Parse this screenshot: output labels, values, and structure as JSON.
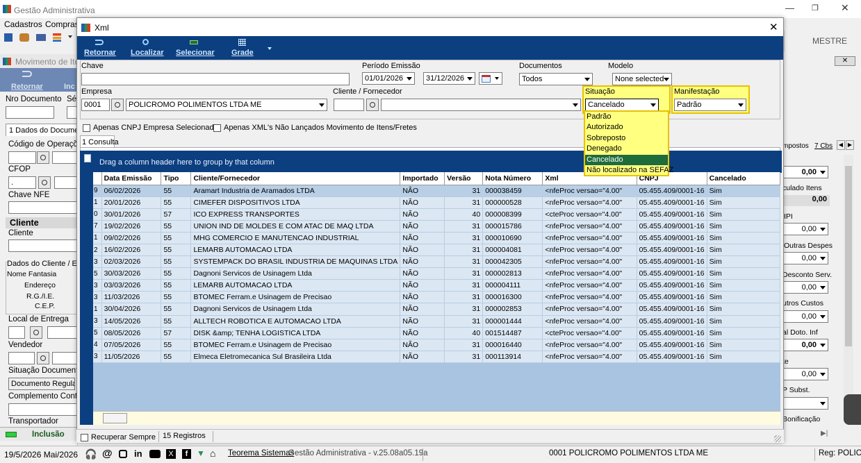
{
  "main_window": {
    "title": "Gestão Administrativa",
    "menu": [
      "Cadastros",
      "Compras"
    ],
    "user": "MESTRE"
  },
  "bg_window": {
    "title": "Movimento de Ite",
    "toolbar": [
      "Retornar",
      "Inc"
    ],
    "fields": {
      "nro_documento": "Nro Documento",
      "serie": "Sé",
      "tab": "1 Dados do Documen",
      "codigo_operacao": "Código de Operaçõ",
      "cfop": "CFOP",
      "cfop_value": ".",
      "chave_nfe": "Chave NFE",
      "cliente_header": "Cliente",
      "cliente": "Cliente",
      "dados_cliente": "Dados do Cliente / E",
      "nome_fantasia": "Nome Fantasia",
      "endereco": "Endereço",
      "rg_ie": "R.G./I.E.",
      "cep": "C.E.P.",
      "local_entrega": "Local de Entrega",
      "vendedor": "Vendedor",
      "situacao_documento": "Situação Documento",
      "situacao_value": "Documento Regular",
      "complemento": "Complemento Cont",
      "transportador": "Transportador"
    },
    "right_panel": {
      "tabs": [
        "mpostos",
        "7 Cbs"
      ],
      "values": [
        "0,00",
        "culado Itens",
        "0,00",
        "IPI",
        "0,00",
        "Outras Despes",
        "0,00",
        "Desconto Serv.",
        "0,00",
        "utros Custos",
        "0,00",
        "al Doto. Inf",
        "0,00",
        "te",
        "0,00",
        "P Subst.",
        "Bonificação"
      ]
    },
    "status_mode": "Inclusão"
  },
  "xml_window": {
    "title": "Xml",
    "toolbar": [
      {
        "label": "Retornar",
        "icon": "undo-icon"
      },
      {
        "label": "Localizar",
        "icon": "search-icon"
      },
      {
        "label": "Selecionar",
        "icon": "select-icon"
      },
      {
        "label": "Grade",
        "icon": "grid-icon"
      }
    ],
    "filters": {
      "chave_label": "Chave",
      "chave_value": "",
      "periodo_label": "Período Emissão",
      "data_inicio": "01/01/2026",
      "data_fim": "31/12/2026",
      "documentos_label": "Documentos",
      "documentos_value": "Todos",
      "modelo_label": "Modelo",
      "modelo_value": "None selected",
      "empresa_label": "Empresa",
      "empresa_codigo": "0001",
      "empresa_nome": "POLICROMO POLIMENTOS LTDA ME",
      "cliente_label": "Cliente / Fornecedor",
      "cliente_codigo": "",
      "cliente_nome": "",
      "situacao_label": "Situação",
      "situacao_value": "Cancelado",
      "manifestacao_label": "Manifestação",
      "manifestacao_value": "Padrão"
    },
    "situacao_options": [
      "Padrão",
      "Autorizado",
      "Sobreposto",
      "Denegado",
      "Cancelado",
      "Não localizado na SEFAZ"
    ],
    "checkboxes": [
      "Apenas CNPJ Empresa Selecionada",
      "Apenas XML's Não Lançados Movimento de Itens/Fretes"
    ],
    "tab": "1 Consulta",
    "group_hint": "Drag a column header here to group by that column",
    "columns": [
      "",
      "Data Emissão",
      "Tipo",
      "Cliente/Fornecedor",
      "Importado",
      "Versão",
      "Nota Número",
      "Xml",
      "CNPJ",
      "Cancelado"
    ],
    "rows": [
      [
        "9",
        "06/02/2026",
        "55",
        "Aramart Industria de Aramados LTDA",
        "NÃO",
        "31",
        "000038459",
        "<nfeProc versao=\"4.00\"",
        "05.455.409/0001-16",
        "Sim"
      ],
      [
        "1",
        "20/01/2026",
        "55",
        "CIMEFER DISPOSITIVOS LTDA",
        "NÃO",
        "31",
        "000000528",
        "<nfeProc versao=\"4.00\"",
        "05.455.409/0001-16",
        "Sim"
      ],
      [
        "0",
        "30/01/2026",
        "57",
        "ICO EXPRESS TRANSPORTES",
        "NÃO",
        "40",
        "000008399",
        "<cteProc versao=\"4.00\"",
        "05.455.409/0001-16",
        "Sim"
      ],
      [
        "7",
        "19/02/2026",
        "55",
        "UNION IND DE MOLDES E COM ATAC DE MAQ LTDA",
        "NÃO",
        "31",
        "000015786",
        "<nfeProc versao=\"4.00\"",
        "05.455.409/0001-16",
        "Sim"
      ],
      [
        "1",
        "09/02/2026",
        "55",
        "MHG COMERCIO E MANUTENCAO INDUSTRIAL",
        "NÃO",
        "31",
        "000010690",
        "<nfeProc versao=\"4.00\"",
        "05.455.409/0001-16",
        "Sim"
      ],
      [
        "2",
        "16/02/2026",
        "55",
        "LEMARB AUTOMACAO LTDA",
        "NÃO",
        "31",
        "000004081",
        "<nfeProc versao=\"4.00\"",
        "05.455.409/0001-16",
        "Sim"
      ],
      [
        "3",
        "02/03/2026",
        "55",
        "SYSTEMPACK DO BRASIL INDUSTRIA DE MAQUINAS LTDA",
        "NÃO",
        "31",
        "000042305",
        "<nfeProc versao=\"4.00\"",
        "05.455.409/0001-16",
        "Sim"
      ],
      [
        "5",
        "30/03/2026",
        "55",
        "Dagnoni Servicos de Usinagem Ltda",
        "NÃO",
        "31",
        "000002813",
        "<nfeProc versao=\"4.00\"",
        "05.455.409/0001-16",
        "Sim"
      ],
      [
        "3",
        "03/03/2026",
        "55",
        "LEMARB AUTOMACAO LTDA",
        "NÃO",
        "31",
        "000004111",
        "<nfeProc versao=\"4.00\"",
        "05.455.409/0001-16",
        "Sim"
      ],
      [
        "3",
        "11/03/2026",
        "55",
        "BTOMEC Ferram.e Usinagem de Precisao",
        "NÃO",
        "31",
        "000016300",
        "<nfeProc versao=\"4.00\"",
        "05.455.409/0001-16",
        "Sim"
      ],
      [
        "1",
        "30/04/2026",
        "55",
        "Dagnoni Servicos de Usinagem Ltda",
        "NÃO",
        "31",
        "000002853",
        "<nfeProc versao=\"4.00\"",
        "05.455.409/0001-16",
        "Sim"
      ],
      [
        "3",
        "14/05/2026",
        "55",
        "ALLTECH ROBOTICA E AUTOMACAO LTDA",
        "NÃO",
        "31",
        "000001444",
        "<nfeProc versao=\"4.00\"",
        "05.455.409/0001-16",
        "Sim"
      ],
      [
        "5",
        "08/05/2026",
        "57",
        "DISK &amp; TENHA LOGISTICA LTDA",
        "NÃO",
        "40",
        "001514487",
        "<cteProc versao=\"4.00\"",
        "05.455.409/0001-16",
        "Sim"
      ],
      [
        "4",
        "07/05/2026",
        "55",
        "BTOMEC Ferram.e Usinagem de Precisao",
        "NÃO",
        "31",
        "000016440",
        "<nfeProc versao=\"4.00\"",
        "05.455.409/0001-16",
        "Sim"
      ],
      [
        "3",
        "11/05/2026",
        "55",
        "Elmeca Eletromecanica Sul Brasileira Ltda",
        "NÃO",
        "31",
        "000113914",
        "<nfeProc versao=\"4.00\"",
        "05.455.409/0001-16",
        "Sim"
      ]
    ],
    "recuperar_sempre": "Recuperar Sempre",
    "registros": "15 Registros"
  },
  "taskbar": {
    "date": "19/5/2026 Mai/2026",
    "company_link": "Teorema Sistemas",
    "version": "Gestão Administrativa - v.25.08a05.19a",
    "empresa": "0001 POLICROMO POLIMENTOS LTDA ME",
    "reg": "Reg: POLICR"
  },
  "colors": {
    "grid_header_bar": "#0a3d7a",
    "highlight_yellow": "#ffff80",
    "highlight_border": "#e6c200",
    "selected_option": "#1e6b3c"
  }
}
